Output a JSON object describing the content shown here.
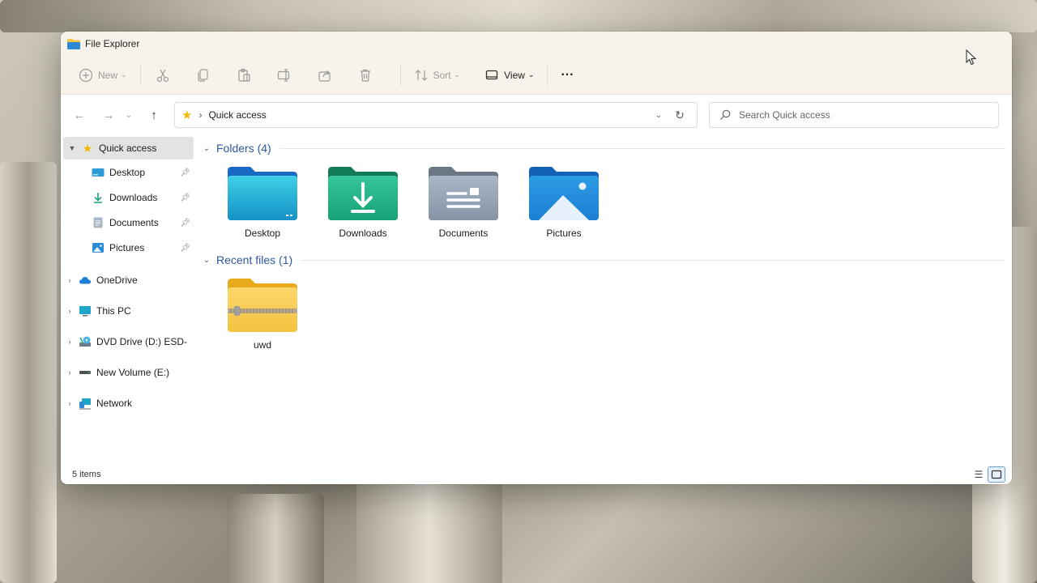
{
  "window": {
    "title": "File Explorer"
  },
  "toolbar": {
    "new_label": "New",
    "sort_label": "Sort",
    "view_label": "View",
    "more_label": "···"
  },
  "address": {
    "crumb": "Quick access",
    "search_placeholder": "Search Quick access"
  },
  "sidebar": {
    "quick_access": "Quick access",
    "pinned": [
      {
        "label": "Desktop",
        "icon": "desktop-icon"
      },
      {
        "label": "Downloads",
        "icon": "download-icon"
      },
      {
        "label": "Documents",
        "icon": "documents-icon"
      },
      {
        "label": "Pictures",
        "icon": "pictures-icon"
      }
    ],
    "drives": [
      {
        "label": "OneDrive",
        "icon": "cloud-icon"
      },
      {
        "label": "This PC",
        "icon": "monitor-icon"
      },
      {
        "label": "DVD Drive (D:) ESD-I",
        "icon": "dvd-icon"
      },
      {
        "label": "New Volume (E:)",
        "icon": "drive-icon"
      },
      {
        "label": "Network",
        "icon": "network-icon"
      }
    ]
  },
  "content": {
    "folders_header": "Folders (4)",
    "folders": [
      {
        "label": "Desktop"
      },
      {
        "label": "Downloads"
      },
      {
        "label": "Documents"
      },
      {
        "label": "Pictures"
      }
    ],
    "recent_header": "Recent files (1)",
    "recent": [
      {
        "label": "uwd"
      }
    ]
  },
  "status": {
    "items": "5 items"
  },
  "colors": {
    "accent": "#2c5aa0",
    "folder_blue": "#1e88d6",
    "folder_green": "#1fa07a",
    "zip_yellow": "#f7c948"
  }
}
